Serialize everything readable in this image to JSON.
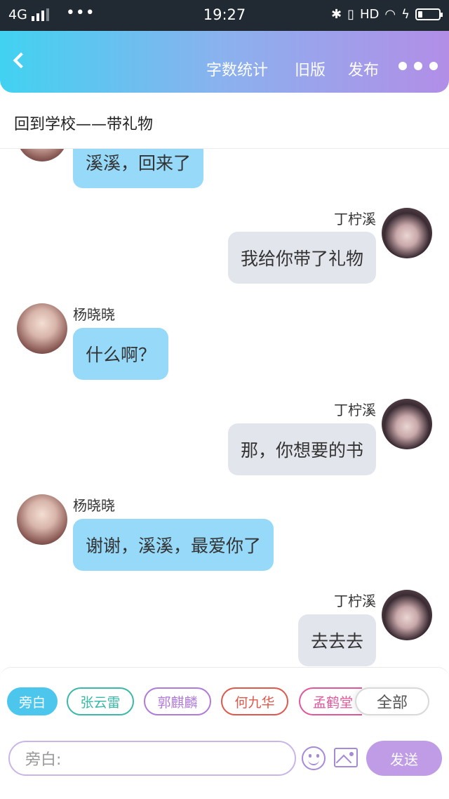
{
  "status_bar": {
    "network": "4G",
    "dots": "•••",
    "time": "19:27",
    "hd": "HD",
    "icons": [
      "bluetooth-icon",
      "vibrate-icon",
      "wifi-icon",
      "charging-icon",
      "battery-icon"
    ]
  },
  "header": {
    "back_icon": "chevron-left-icon",
    "word_count": "字数统计",
    "old_version": "旧版",
    "publish": "发布",
    "more_icon": "more-dots-icon",
    "gradient": [
      "#41d2f1",
      "#b28ee7"
    ]
  },
  "chapter": {
    "title": "回到学校——带礼物"
  },
  "messages": [
    {
      "side": "left",
      "name": "",
      "text": "溪溪，回来了"
    },
    {
      "side": "right",
      "name": "丁柠溪",
      "text": "我给你带了礼物"
    },
    {
      "side": "left",
      "name": "杨晓晓",
      "text": "什么啊？"
    },
    {
      "side": "right",
      "name": "丁柠溪",
      "text": "那，你想要的书"
    },
    {
      "side": "left",
      "name": "杨晓晓",
      "text": "谢谢，溪溪，最爱你了"
    },
    {
      "side": "right",
      "name": "丁柠溪",
      "text": "去去去"
    }
  ],
  "characters": [
    {
      "label": "旁白",
      "color": "#4dc6ee",
      "active": true
    },
    {
      "label": "张云雷",
      "color": "#3bb8a8",
      "active": false
    },
    {
      "label": "郭麒麟",
      "color": "#b07ad8",
      "active": false
    },
    {
      "label": "何九华",
      "color": "#e0574b",
      "active": false
    },
    {
      "label": "孟鹤堂",
      "color": "#e0579a",
      "active": false
    },
    {
      "label": "全部",
      "color": "#555555",
      "active": false
    }
  ],
  "composer": {
    "placeholder": "旁白:",
    "emoji_icon": "smiley-icon",
    "image_icon": "image-icon",
    "send_label": "发送"
  },
  "colors": {
    "left_bubble": "#96d9f8",
    "right_bubble": "#e2e6ec",
    "accent": "#c09ce6"
  }
}
